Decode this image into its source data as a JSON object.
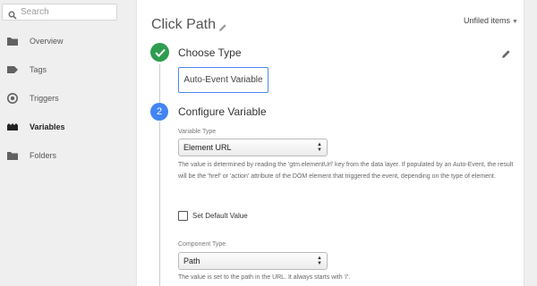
{
  "sidebar": {
    "search_placeholder": "Search",
    "items": [
      {
        "label": "Overview",
        "icon": "folder-icon"
      },
      {
        "label": "Tags",
        "icon": "tag-icon"
      },
      {
        "label": "Triggers",
        "icon": "trigger-icon"
      },
      {
        "label": "Variables",
        "icon": "variables-icon"
      },
      {
        "label": "Folders",
        "icon": "folder-icon"
      }
    ]
  },
  "header": {
    "title": "Click Path",
    "folder_label": "Unfiled items",
    "folder_caret": "▼"
  },
  "step1": {
    "title": "Choose Type",
    "selected_type": "Auto-Event Variable"
  },
  "step2": {
    "number": "2",
    "title": "Configure Variable",
    "variable_type_label": "Variable Type",
    "variable_type_value": "Element URL",
    "variable_type_help": "The value is determined by reading the 'gtm.elementUrl' key from the data layer. If populated by an Auto-Event, the result will be the 'href' or 'action' attribute of the DOM element that triggered the event, depending on the type of element.",
    "default_value_label": "Set Default Value",
    "component_type_label": "Component Type",
    "component_type_value": "Path",
    "component_type_help": "The value is set to the path in the URL. It always starts with '/'."
  },
  "colors": {
    "accent": "#4285f4",
    "success": "#2e9d4f"
  }
}
